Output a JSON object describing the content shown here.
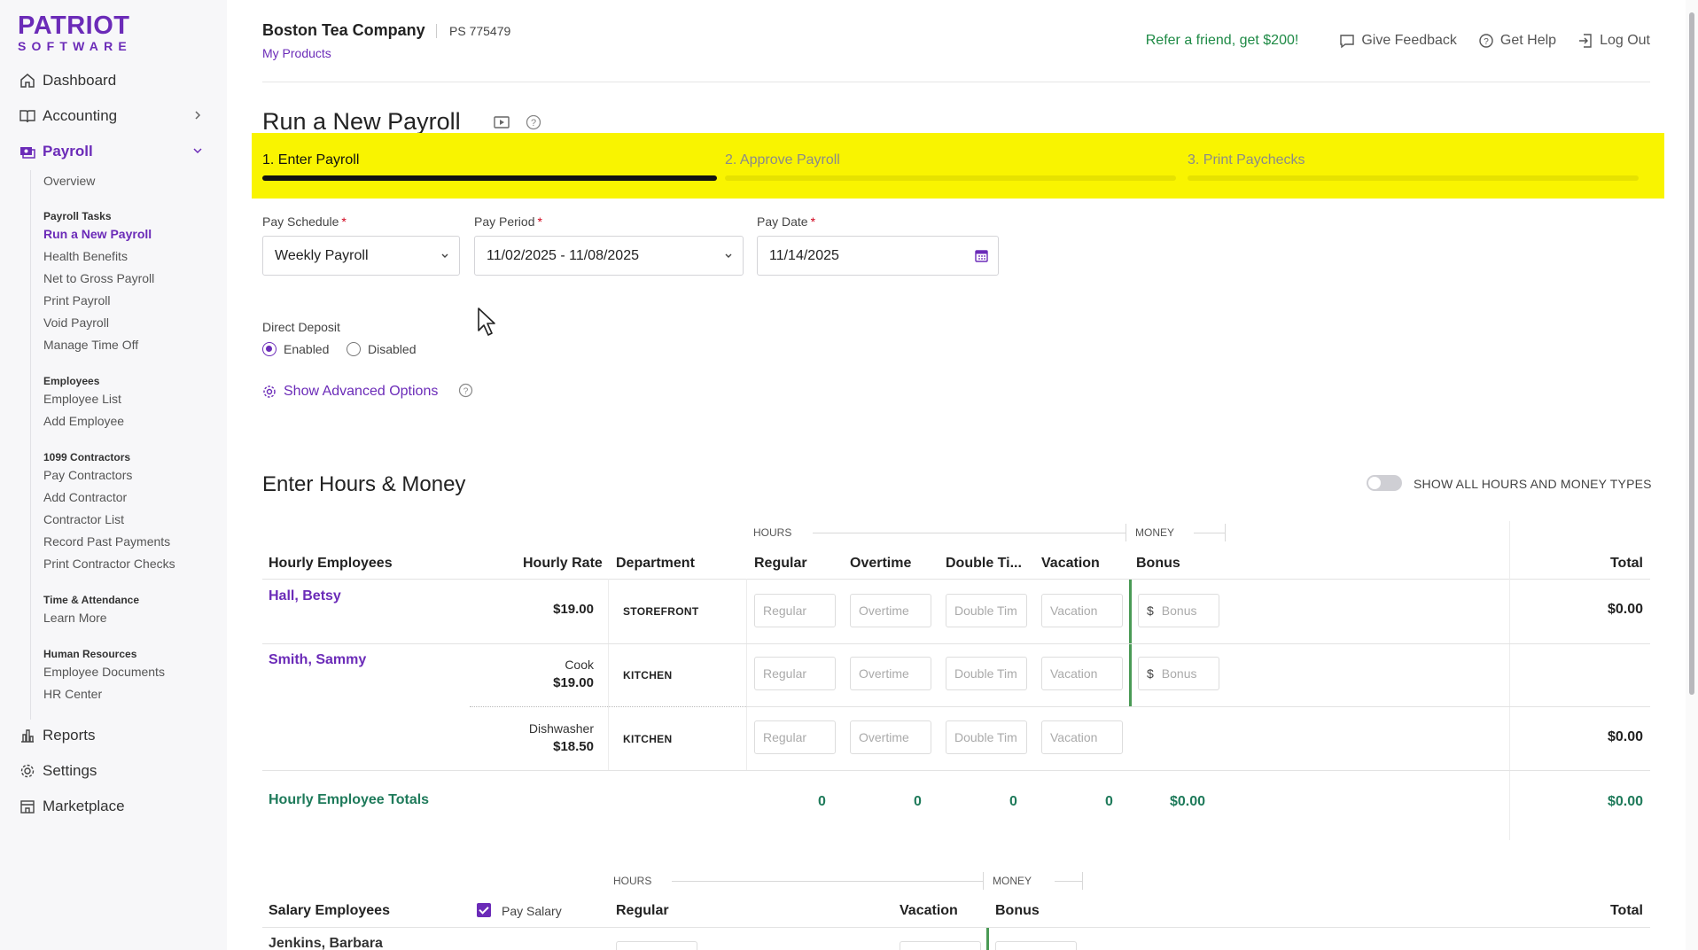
{
  "logo": {
    "line1": "PATRIOT",
    "line2": "SOFTWARE"
  },
  "sidebar": {
    "top": [
      {
        "label": "Dashboard",
        "icon": "home-icon"
      },
      {
        "label": "Accounting",
        "icon": "book-icon"
      },
      {
        "label": "Payroll",
        "icon": "payroll-icon"
      }
    ],
    "payroll_sub": {
      "overview": "Overview",
      "tasks_header": "Payroll Tasks",
      "tasks": [
        "Run a New Payroll",
        "Health Benefits",
        "Net to Gross Payroll",
        "Print Payroll",
        "Void Payroll",
        "Manage Time Off"
      ],
      "employees_header": "Employees",
      "employees": [
        "Employee List",
        "Add Employee"
      ],
      "contractors_header": "1099 Contractors",
      "contractors": [
        "Pay Contractors",
        "Add Contractor",
        "Contractor List",
        "Record Past Payments",
        "Print Contractor Checks"
      ],
      "time_header": "Time & Attendance",
      "time": [
        "Learn More"
      ],
      "hr_header": "Human Resources",
      "hr": [
        "Employee Documents",
        "HR Center"
      ]
    },
    "bottom": [
      {
        "label": "Reports",
        "icon": "chart-icon"
      },
      {
        "label": "Settings",
        "icon": "gear-icon"
      },
      {
        "label": "Marketplace",
        "icon": "store-icon"
      }
    ]
  },
  "header": {
    "company": "Boston Tea Company",
    "ps_number": "PS 775479",
    "my_products": "My Products",
    "refer": "Refer a friend, get $200!",
    "feedback": "Give Feedback",
    "help": "Get Help",
    "logout": "Log Out"
  },
  "page": {
    "title": "Run a New Payroll"
  },
  "steps": [
    {
      "label": "1. Enter Payroll",
      "state": "active"
    },
    {
      "label": "2. Approve Payroll",
      "state": "inactive"
    },
    {
      "label": "3. Print Paychecks",
      "state": "inactive"
    }
  ],
  "form": {
    "pay_schedule": {
      "label": "Pay Schedule",
      "value": "Weekly Payroll"
    },
    "pay_period": {
      "label": "Pay Period",
      "value": "11/02/2025 - 11/08/2025"
    },
    "pay_date": {
      "label": "Pay Date",
      "value": "11/14/2025"
    },
    "required_mark": "*",
    "direct_deposit": {
      "label": "Direct Deposit",
      "enabled": "Enabled",
      "disabled": "Disabled",
      "selected": "Enabled"
    },
    "advanced": "Show Advanced Options"
  },
  "hours": {
    "title": "Enter Hours & Money",
    "toggle_label": "SHOW ALL HOURS AND MONEY TYPES",
    "group_hours": "HOURS",
    "group_money": "MONEY",
    "columns": {
      "employees": "Hourly Employees",
      "rate": "Hourly Rate",
      "department": "Department",
      "regular": "Regular",
      "overtime": "Overtime",
      "double": "Double Ti...",
      "vacation": "Vacation",
      "bonus": "Bonus",
      "total": "Total"
    },
    "placeholders": {
      "regular": "Regular",
      "overtime": "Overtime",
      "double": "Double Tim",
      "vacation": "Vacation",
      "bonus": "Bonus",
      "currency": "$"
    },
    "rows": [
      {
        "name": "Hall, Betsy",
        "job": "",
        "rate": "$19.00",
        "dept": "STOREFRONT",
        "total": "$0.00"
      },
      {
        "name": "Smith, Sammy",
        "job": "Cook",
        "rate": "$19.00",
        "dept": "KITCHEN",
        "total": ""
      },
      {
        "name": "",
        "job": "Dishwasher",
        "rate": "$18.50",
        "dept": "KITCHEN",
        "total": "$0.00"
      }
    ],
    "totals": {
      "label": "Hourly Employee Totals",
      "regular": "0",
      "overtime": "0",
      "double": "0",
      "vacation": "0",
      "bonus": "$0.00",
      "total": "$0.00"
    }
  },
  "salary": {
    "group_hours": "HOURS",
    "group_money": "MONEY",
    "columns": {
      "employees": "Salary Employees",
      "pay_salary": "Pay Salary",
      "regular": "Regular",
      "vacation": "Vacation",
      "bonus": "Bonus",
      "total": "Total"
    },
    "first_row": "Jenkins, Barbara"
  },
  "colors": {
    "brand": "#6b2bb8",
    "highlight": "#f9f400",
    "green": "#1e8a45"
  }
}
